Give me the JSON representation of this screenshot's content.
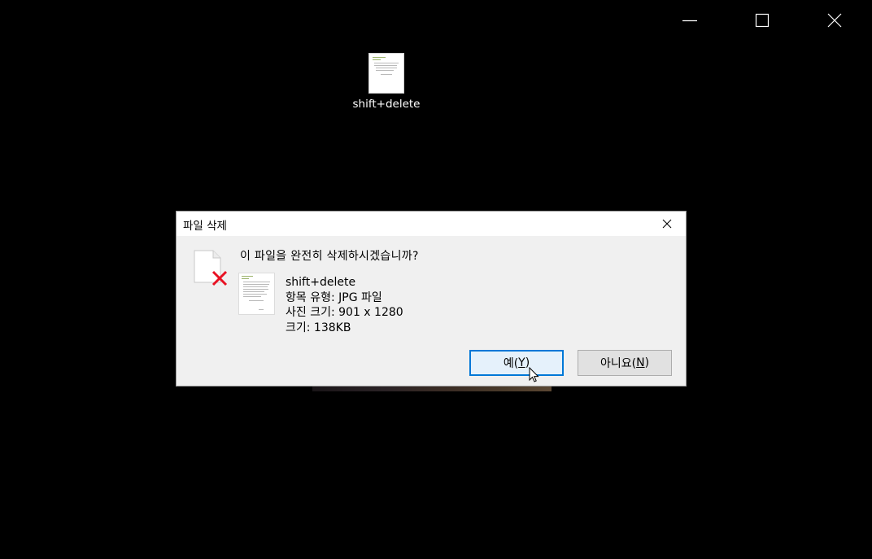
{
  "window": {
    "controls": {
      "minimize_icon": "minimize-icon",
      "maximize_icon": "maximize-icon",
      "close_icon": "close-icon"
    }
  },
  "desktop": {
    "file": {
      "label": "shift+delete"
    }
  },
  "dialog": {
    "title": "파일 삭제",
    "question": "이 파일을 완전히 삭제하시겠습니까?",
    "file": {
      "name": "shift+delete",
      "type": "항목 유형: JPG 파일",
      "dimensions": "사진 크기: 901 x 1280",
      "size": "크기: 138KB"
    },
    "buttons": {
      "yes_label": "예(",
      "yes_key": "Y",
      "yes_close": ")",
      "no_label": "아니요(",
      "no_key": "N",
      "no_close": ")"
    }
  },
  "colors": {
    "background": "#000000",
    "dialog_bg": "#f0f0f0",
    "accent": "#0078d7",
    "delete_red": "#e81123"
  }
}
